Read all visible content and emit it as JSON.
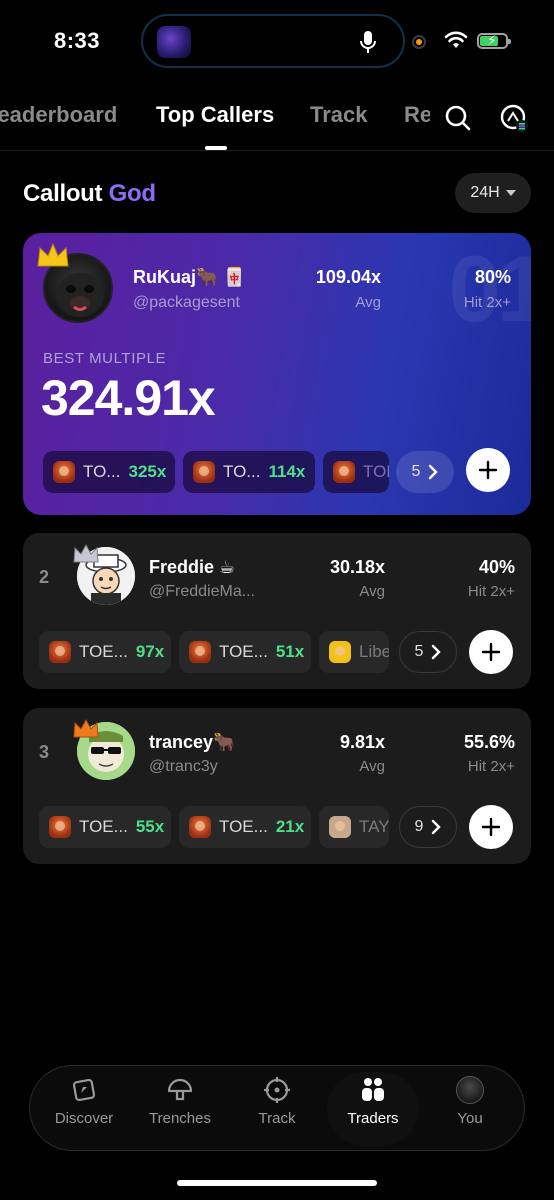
{
  "status_bar": {
    "time": "8:33"
  },
  "tabs": [
    {
      "label": "Leaderboard",
      "active": false
    },
    {
      "label": "Top Callers",
      "active": true
    },
    {
      "label": "Track",
      "active": false
    },
    {
      "label": "Re",
      "active": false
    }
  ],
  "section": {
    "title": "Callout ",
    "title_accent": "God",
    "period": "24H"
  },
  "hero": {
    "rank_watermark": "01",
    "name": "RuKuaj🐂 🀄",
    "handle": "@packagesent",
    "avg_value": "109.04x",
    "avg_label": "Avg",
    "hit_value": "80%",
    "hit_label": "Hit 2x+",
    "best_label": "BEST MULTIPLE",
    "best_value": "324.91x",
    "chips": [
      {
        "symbol": "TO...",
        "multiple": "325x"
      },
      {
        "symbol": "TO...",
        "multiple": "114x"
      },
      {
        "symbol": "TOE",
        "multiple": ""
      }
    ],
    "more_count": "5"
  },
  "callers": [
    {
      "rank": "2",
      "name": "Freddie ☕",
      "handle": "@FreddieMa...",
      "avg_value": "30.18x",
      "avg_label": "Avg",
      "hit_value": "40%",
      "hit_label": "Hit 2x+",
      "chips": [
        {
          "symbol": "TOE...",
          "multiple": "97x"
        },
        {
          "symbol": "TOE...",
          "multiple": "51x"
        },
        {
          "symbol": "Libe",
          "multiple": ""
        }
      ],
      "more_count": "5"
    },
    {
      "rank": "3",
      "name": "trancey🐂",
      "handle": "@tranc3y",
      "avg_value": "9.81x",
      "avg_label": "Avg",
      "hit_value": "55.6%",
      "hit_label": "Hit 2x+",
      "chips": [
        {
          "symbol": "TOE...",
          "multiple": "55x"
        },
        {
          "symbol": "TOE...",
          "multiple": "21x"
        },
        {
          "symbol": "TAYL",
          "multiple": ""
        }
      ],
      "more_count": "9"
    }
  ],
  "bottom_nav": [
    {
      "label": "Discover",
      "icon": "compass-icon",
      "active": false
    },
    {
      "label": "Trenches",
      "icon": "mushroom-icon",
      "active": false
    },
    {
      "label": "Track",
      "icon": "crosshair-icon",
      "active": false
    },
    {
      "label": "Traders",
      "icon": "users-icon",
      "active": true
    },
    {
      "label": "You",
      "icon": "avatar",
      "active": false
    }
  ],
  "colors": {
    "accent": "#8b6cf6",
    "gain": "#4de08b",
    "hero_start": "#5b1f9e",
    "hero_end": "#1b2a9a"
  }
}
